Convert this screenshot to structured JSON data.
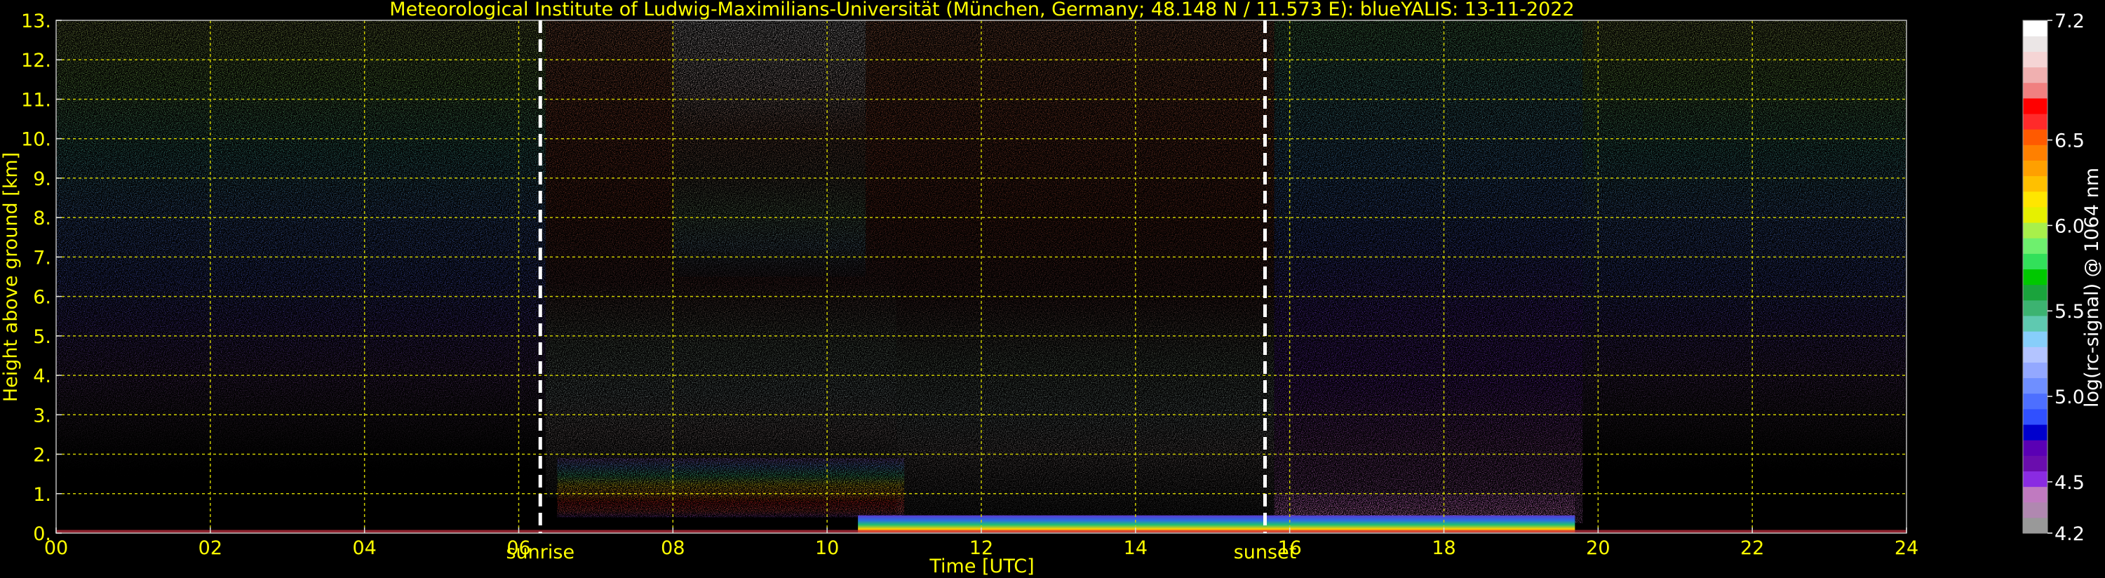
{
  "chart_data": {
    "type": "heatmap",
    "title": "Meteorological Institute of Ludwig-Maximilians-Universität (München, Germany; 48.148 N / 11.573 E):     blueYALIS: 13-11-2022",
    "xlabel": "Time [UTC]",
    "ylabel": "Height above ground [km]",
    "xlim": [
      0,
      24
    ],
    "ylim": [
      0,
      13
    ],
    "x_ticks": [
      0,
      2,
      4,
      6,
      8,
      10,
      12,
      14,
      16,
      18,
      20,
      22,
      24
    ],
    "x_tick_labels": [
      "00",
      "02",
      "04",
      "06",
      "08",
      "10",
      "12",
      "14",
      "16",
      "18",
      "20",
      "22",
      "24"
    ],
    "y_ticks": [
      0,
      1,
      2,
      3,
      4,
      5,
      6,
      7,
      8,
      9,
      10,
      11,
      12,
      13
    ],
    "y_tick_labels": [
      "0.",
      "1.",
      "2.",
      "3.",
      "4.",
      "5.",
      "6.",
      "7.",
      "8.",
      "9.",
      "10.",
      "11.",
      "12.",
      "13."
    ],
    "grid": true,
    "markers": [
      {
        "label": "sunrise",
        "x": 6.28
      },
      {
        "label": "sunset",
        "x": 15.68
      }
    ],
    "colorbar": {
      "label": "log(rc-signal) @ 1064 nm",
      "range": [
        4.2,
        7.2
      ],
      "tick_values": [
        4.2,
        4.5,
        5.0,
        5.5,
        6.0,
        6.5,
        7.2
      ],
      "tick_labels": [
        "4.2",
        "4.5",
        "5.0",
        "5.5",
        "6.0",
        "6.5",
        "7.2"
      ],
      "colors": [
        "#999999",
        "#b088b0",
        "#c07ac0",
        "#8a2be2",
        "#6a0dad",
        "#5a00b4",
        "#0000cd",
        "#3050ff",
        "#4d6fff",
        "#6f8fff",
        "#93a8ff",
        "#b3c4ff",
        "#87cefa",
        "#5fc9b0",
        "#3cb371",
        "#1aa33c",
        "#00c800",
        "#32e05a",
        "#6ef06e",
        "#a8f04b",
        "#e6f000",
        "#ffe600",
        "#ffc000",
        "#ffa000",
        "#ff8000",
        "#ff5a00",
        "#ff2a2a",
        "#ff0000",
        "#f08080",
        "#f0b0b0",
        "#f5d5d5",
        "#ebe6e6",
        "#ffffff"
      ]
    }
  }
}
